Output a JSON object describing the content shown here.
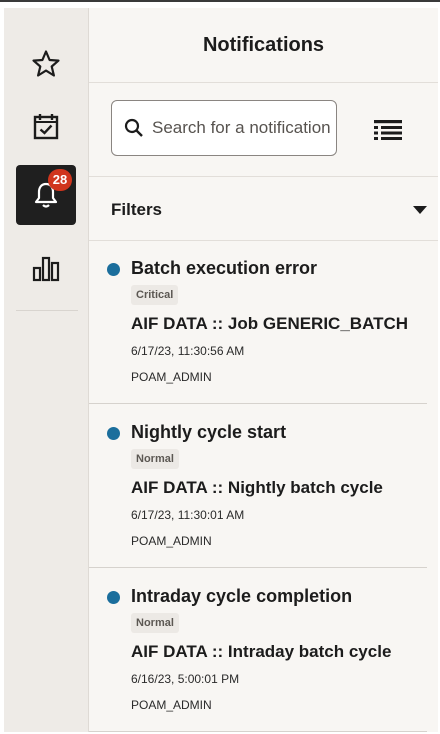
{
  "rail": {
    "items": [
      {
        "name": "favorites",
        "icon": "star-icon",
        "active": false
      },
      {
        "name": "tasks",
        "icon": "calendar-check-icon",
        "active": false
      },
      {
        "name": "notifications",
        "icon": "bell-icon",
        "active": true,
        "badge": "28"
      },
      {
        "name": "analytics",
        "icon": "bar-chart-icon",
        "active": false
      }
    ]
  },
  "panel": {
    "title": "Notifications",
    "search": {
      "placeholder": "Search for a notification",
      "value": ""
    },
    "list_icon": "list-view-icon",
    "filters_label": "Filters"
  },
  "notifications": [
    {
      "title": "Batch execution error",
      "severity": "Critical",
      "message": "AIF DATA :: Job GENERIC_BATCH",
      "date": "6/17/23, 11:30:56 AM",
      "user": "POAM_ADMIN"
    },
    {
      "title": "Nightly cycle start",
      "severity": "Normal",
      "message": "AIF DATA :: Nightly batch cycle",
      "date": "6/17/23, 11:30:01 AM",
      "user": "POAM_ADMIN"
    },
    {
      "title": "Intraday cycle completion",
      "severity": "Normal",
      "message": "AIF DATA :: Intraday batch cycle",
      "date": "6/16/23, 5:00:01 PM",
      "user": "POAM_ADMIN"
    }
  ],
  "colors": {
    "accent_dot": "#1b6e9c",
    "badge": "#d0351d",
    "active_rail": "#1f1f1f"
  }
}
